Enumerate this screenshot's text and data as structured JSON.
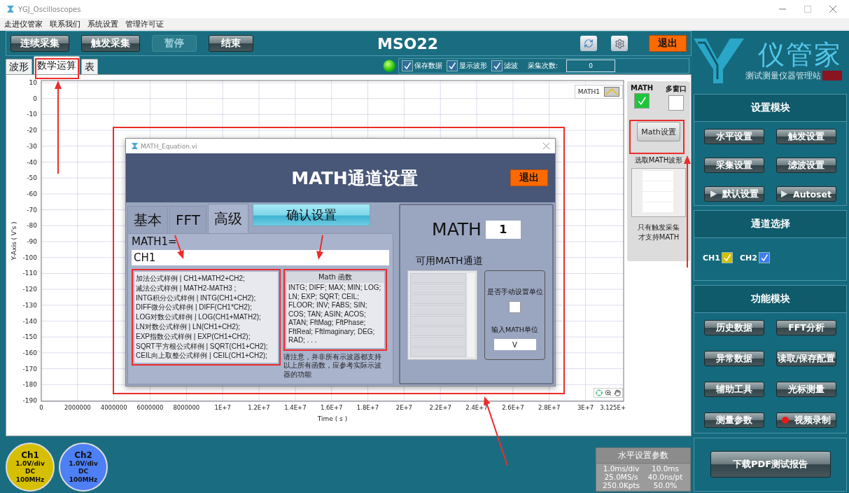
{
  "window": {
    "title": "YGJ_Oscilloscopes"
  },
  "menu": [
    {
      "label": "走进仪管家"
    },
    {
      "label": "联系我们"
    },
    {
      "label": "系统设置"
    },
    {
      "label": "管理许可证"
    }
  ],
  "toolbar": {
    "buttons": [
      {
        "label": "连续采集",
        "disabled": false
      },
      {
        "label": "触发采集",
        "disabled": false
      },
      {
        "label": "暂停",
        "disabled": true
      },
      {
        "label": "结束",
        "disabled": false
      }
    ],
    "title": "MSO22",
    "exit": "退出"
  },
  "tabs": [
    {
      "label": "波形",
      "selected": false
    },
    {
      "label": "数学运算",
      "selected": true
    },
    {
      "label": "表",
      "selected": false
    }
  ],
  "status": {
    "led_on": true,
    "checks": [
      {
        "label": "保存数据",
        "checked": true
      },
      {
        "label": "显示波形",
        "checked": true
      },
      {
        "label": "滤波",
        "checked": true
      }
    ],
    "count_label": "采集次数:",
    "count": "0"
  },
  "plot": {
    "legend": "MATH1",
    "x_end_label": "3.125E+",
    "chart_data": {
      "type": "line",
      "xlabel": "Time ( s )",
      "ylabel": "Y-Axis ( V's )",
      "xlim": [
        0,
        32100000
      ],
      "ylim": [
        -190,
        10
      ],
      "xticks": [
        {
          "value": 0,
          "label": "0"
        },
        {
          "value": 2000000,
          "label": "2000000"
        },
        {
          "value": 4000000,
          "label": "4000000"
        },
        {
          "value": 6000000,
          "label": "6000000"
        },
        {
          "value": 8000000,
          "label": "8000000"
        },
        {
          "value": 10000000,
          "label": "1E+7"
        },
        {
          "value": 12000000,
          "label": "1.2E+7"
        },
        {
          "value": 14000000,
          "label": "1.4E+7"
        },
        {
          "value": 16000000,
          "label": "1.6E+7"
        },
        {
          "value": 18000000,
          "label": "1.8E+7"
        },
        {
          "value": 20000000,
          "label": "2E+7"
        },
        {
          "value": 22000000,
          "label": "2.2E+7"
        },
        {
          "value": 24000000,
          "label": "2.4E+7"
        },
        {
          "value": 26000000,
          "label": "2.6E+7"
        },
        {
          "value": 28000000,
          "label": "2.8E+7"
        },
        {
          "value": 30000000,
          "label": "3E+7"
        }
      ],
      "grid": true,
      "yticks": [
        10,
        0,
        -10,
        -20,
        -30,
        -40,
        -50,
        -60,
        -70,
        -80,
        -90,
        -100,
        -110,
        -120,
        -130,
        -140,
        -150,
        -160,
        -170,
        -180,
        -190
      ]
    }
  },
  "math_panel": {
    "math_label": "MATH",
    "math_checked": true,
    "multi_label": "多窗口",
    "multi_checked": false,
    "button": "Math设置",
    "select_label": "选取MATH波形",
    "note": "只有触发采集才支持MATH"
  },
  "channels": [
    {
      "name": "Ch1",
      "scale": "1.0V/div",
      "coupling": "DC",
      "bandwidth": "100MHz",
      "color": "#d6bf00"
    },
    {
      "name": "Ch2",
      "scale": "1.0V/div",
      "coupling": "DC",
      "bandwidth": "100MHz",
      "color": "#4d7ff5"
    }
  ],
  "horizontal": {
    "title": "水平设置参数",
    "rows": [
      [
        "1.0ms/div",
        "10.0ms"
      ],
      [
        "25.0MS/s",
        "40.0ns/pt"
      ],
      [
        "250.0Kpts",
        "50.0%"
      ]
    ]
  },
  "logo": {
    "name": "仪管家",
    "subtitle": "测试测量仪器管理站"
  },
  "settings_module": {
    "title": "设置模块",
    "buttons": [
      {
        "label": "水平设置",
        "kind": "plain"
      },
      {
        "label": "触发设置",
        "kind": "plain"
      },
      {
        "label": "采集设置",
        "kind": "plain"
      },
      {
        "label": "滤波设置",
        "kind": "plain"
      },
      {
        "label": "默认设置",
        "kind": "play"
      },
      {
        "label": "Autoset",
        "kind": "play"
      }
    ]
  },
  "channel_select": {
    "title": "通道选择",
    "items": [
      {
        "label": "CH1",
        "checked": true,
        "color": "#d6bf00"
      },
      {
        "label": "CH2",
        "checked": true,
        "color": "#3f7df0"
      }
    ]
  },
  "function_module": {
    "title": "功能模块",
    "buttons": [
      {
        "label": "历史数据",
        "kind": "plain"
      },
      {
        "label": "FFT分析",
        "kind": "plain"
      },
      {
        "label": "异常数据",
        "kind": "plain"
      },
      {
        "label": "读取/保存配置",
        "kind": "plain"
      },
      {
        "label": "辅助工具",
        "kind": "plain"
      },
      {
        "label": "光标测量",
        "kind": "plain"
      },
      {
        "label": "测量参数",
        "kind": "plain"
      },
      {
        "label": "视频录制",
        "kind": "record"
      }
    ]
  },
  "report_button": "下载PDF测试报告",
  "dialog": {
    "title": "MATH_Equation.vi",
    "header": "MATH通道设置",
    "exit": "退出",
    "tabs": [
      {
        "label": "基本",
        "selected": false
      },
      {
        "label": "FFT",
        "selected": false
      },
      {
        "label": "高级",
        "selected": true
      }
    ],
    "confirm": "确认设置",
    "expr_label": "MATH1=",
    "expr_value": "CH1",
    "examples": [
      "加法公式样例 | CH1+MATH2+CH2;",
      "减法公式样例 | MATH2-MATH3 ;",
      "INTG积分公式样例 | INTG(CH1+CH2);",
      "DIFF微分公式样例 | DIFF(CH1*CH2);",
      "LOG对数公式样例 | LOG(CH1+MATH2);",
      "LN对数公式样例 | LN(CH1+CH2);",
      "EXP指数公式样例 | EXP(CH1+CH2);",
      "SQRT平方根公式样例 | SQRT(CH1+CH2);",
      "CEIL向上取整公式样例 | CEIL(CH1+CH2);"
    ],
    "functions_title": "Math 函数",
    "functions": "INTG; DIFF; MAX; MIN; LOG; LN; EXP; SQRT; CEIL; FLOOR; INV; FABS; SIN; COS; TAN; ASIN; ACOS; ATAN; FftMag; FftPhase; FftReal; FftImaginary; DEG; RAD; . . .",
    "note": "请注意，并非所有示波器都支持以上所有函数，应参考实际示波器的功能",
    "math_label": "MATH",
    "math_index": "1",
    "available_label": "可用MATH通道",
    "manual_label": "是否手动设置单位",
    "manual_checked": false,
    "unit_label": "输入MATH单位",
    "unit_value": "V"
  }
}
